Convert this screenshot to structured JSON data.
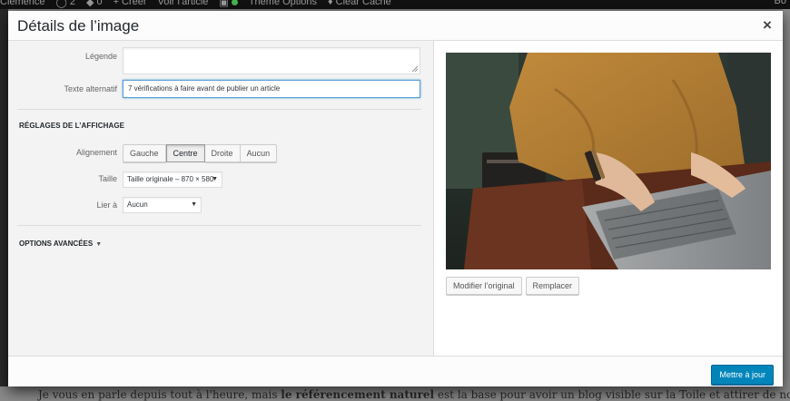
{
  "adminbar": {
    "site": "Clémence",
    "comments_count": "2",
    "pending_count": "0",
    "new_label": "Créer",
    "view_article": "Voir l'article",
    "theme_options": "Thème Options",
    "clear_cache": "Clear Cache",
    "right_text": "Bo"
  },
  "modal": {
    "title": "Détails de l’image",
    "close_symbol": "×",
    "fields": {
      "caption_label": "Légende",
      "caption_value": "",
      "alt_label": "Texte alternatif",
      "alt_value": "7 vérifications à faire avant de publier un article"
    },
    "display_settings": {
      "title": "RÉGLAGES DE L’AFFICHAGE",
      "alignment_label": "Alignement",
      "alignment_options": [
        "Gauche",
        "Centre",
        "Droite",
        "Aucun"
      ],
      "alignment_selected": "Centre",
      "size_label": "Taille",
      "size_value": "Taille originale – 870 × 580",
      "link_label": "Lier à",
      "link_value": "Aucun"
    },
    "advanced_options": "OPTIONS AVANCÉES",
    "image_buttons": {
      "edit_original": "Modifier l’original",
      "replace": "Remplacer"
    },
    "update_button": "Mettre à jour"
  },
  "background": {
    "text_before": "Je vous en parle depuis tout à l'heure, mais ",
    "text_bold": "le référencement naturel",
    "text_after": " est la base pour avoir un blog visible sur la Toile et attirer de nouveaux"
  },
  "colors": {
    "primary": "#0085ba",
    "focus": "#5b9dd9"
  }
}
